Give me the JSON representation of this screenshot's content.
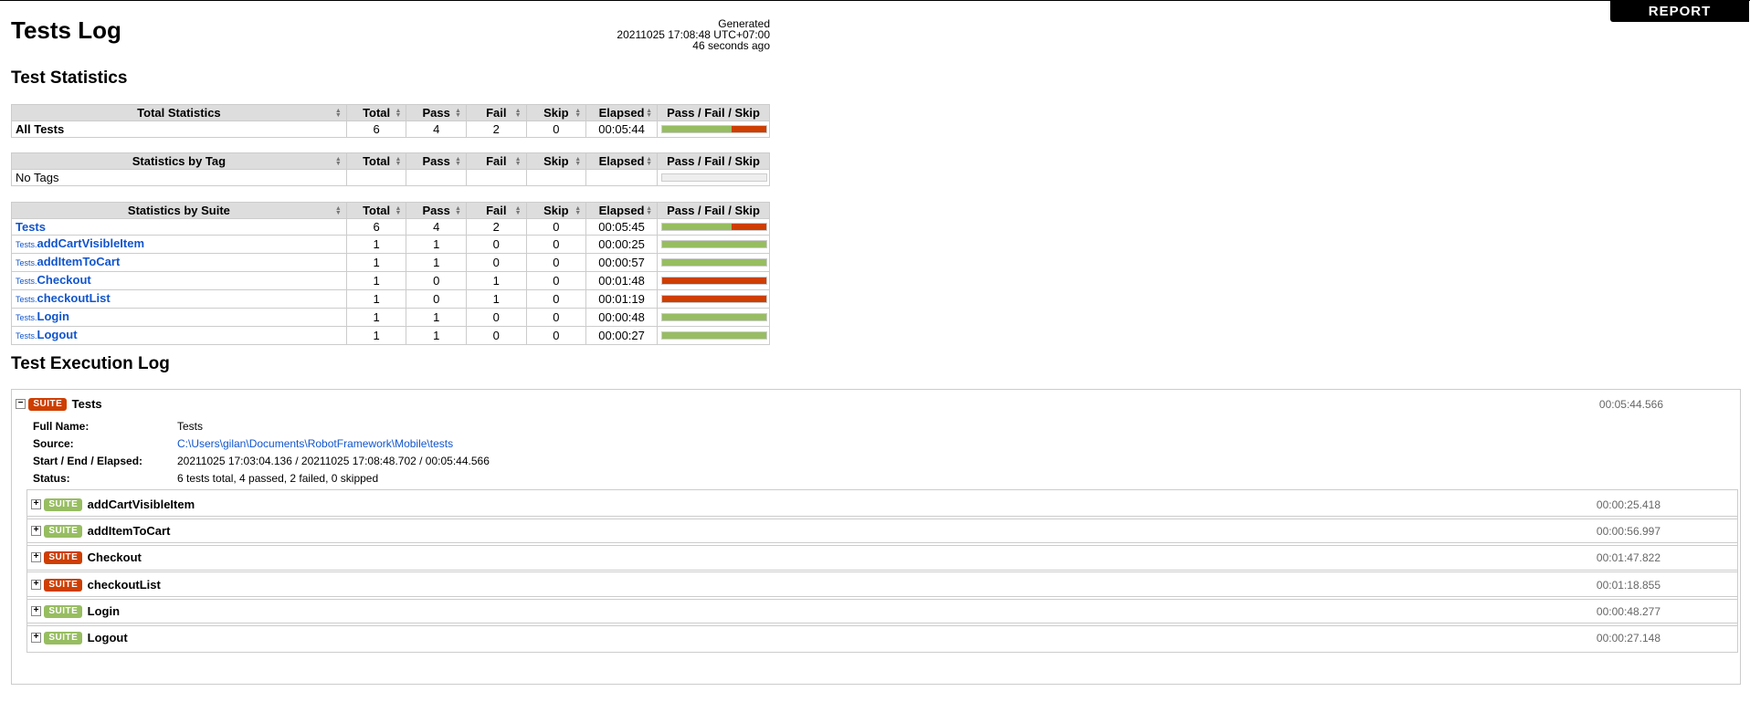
{
  "report_link": "REPORT",
  "title": "Tests Log",
  "generated": {
    "label": "Generated",
    "timestamp": "20211025 17:08:48 UTC+07:00",
    "ago": "46 seconds ago"
  },
  "sections": {
    "statistics": "Test Statistics",
    "execution": "Test Execution Log"
  },
  "columns": [
    "Total",
    "Pass",
    "Fail",
    "Skip",
    "Elapsed",
    "Pass / Fail / Skip"
  ],
  "total_stats": {
    "header": "Total Statistics",
    "rows": [
      {
        "name": "All Tests",
        "total": "6",
        "pass": "4",
        "fail": "2",
        "skip": "0",
        "elapsed": "00:05:44",
        "pass_ratio": 0.667,
        "fail_ratio": 0.333
      }
    ]
  },
  "tag_stats": {
    "header": "Statistics by Tag",
    "rows": [
      {
        "name": "No Tags",
        "total": "",
        "pass": "",
        "fail": "",
        "skip": "",
        "elapsed": "",
        "pass_ratio": 0,
        "fail_ratio": 0
      }
    ]
  },
  "suite_stats": {
    "header": "Statistics by Suite",
    "rows": [
      {
        "parent": "",
        "name": "Tests",
        "total": "6",
        "pass": "4",
        "fail": "2",
        "skip": "0",
        "elapsed": "00:05:45",
        "pass_ratio": 0.667,
        "fail_ratio": 0.333
      },
      {
        "parent": "Tests.",
        "name": "addCartVisibleItem",
        "total": "1",
        "pass": "1",
        "fail": "0",
        "skip": "0",
        "elapsed": "00:00:25",
        "pass_ratio": 1,
        "fail_ratio": 0
      },
      {
        "parent": "Tests.",
        "name": "addItemToCart",
        "total": "1",
        "pass": "1",
        "fail": "0",
        "skip": "0",
        "elapsed": "00:00:57",
        "pass_ratio": 1,
        "fail_ratio": 0
      },
      {
        "parent": "Tests.",
        "name": "Checkout",
        "total": "1",
        "pass": "0",
        "fail": "1",
        "skip": "0",
        "elapsed": "00:01:48",
        "pass_ratio": 0,
        "fail_ratio": 1
      },
      {
        "parent": "Tests.",
        "name": "checkoutList",
        "total": "1",
        "pass": "0",
        "fail": "1",
        "skip": "0",
        "elapsed": "00:01:19",
        "pass_ratio": 0,
        "fail_ratio": 1
      },
      {
        "parent": "Tests.",
        "name": "Login",
        "total": "1",
        "pass": "1",
        "fail": "0",
        "skip": "0",
        "elapsed": "00:00:48",
        "pass_ratio": 1,
        "fail_ratio": 0
      },
      {
        "parent": "Tests.",
        "name": "Logout",
        "total": "1",
        "pass": "1",
        "fail": "0",
        "skip": "0",
        "elapsed": "00:00:27",
        "pass_ratio": 1,
        "fail_ratio": 0
      }
    ]
  },
  "colors": {
    "pass": "#97bd61",
    "fail": "#ce3e01",
    "link": "#1155cc"
  },
  "execution": {
    "toggle": "−",
    "label": "SUITE",
    "name": "Tests",
    "elapsed": "00:05:44.566",
    "meta": [
      {
        "key": "Full Name:",
        "value": "Tests",
        "link": false
      },
      {
        "key": "Source:",
        "value": "C:\\Users\\gilan\\Documents\\RobotFramework\\Mobile\\tests",
        "link": true
      },
      {
        "key": "Start / End / Elapsed:",
        "value": "20211025 17:03:04.136 / 20211025 17:08:48.702 / 00:05:44.566",
        "link": false
      },
      {
        "key": "Status:",
        "value": "6 tests total, 4 passed, 2 failed, 0 skipped",
        "link": false
      }
    ],
    "children": [
      {
        "toggle": "+",
        "label": "SUITE",
        "status": "pass",
        "name": "addCartVisibleItem",
        "elapsed": "00:00:25.418"
      },
      {
        "toggle": "+",
        "label": "SUITE",
        "status": "pass",
        "name": "addItemToCart",
        "elapsed": "00:00:56.997"
      },
      {
        "toggle": "+",
        "label": "SUITE",
        "status": "fail",
        "name": "Checkout",
        "elapsed": "00:01:47.822"
      },
      {
        "toggle": "+",
        "label": "SUITE",
        "status": "fail",
        "name": "checkoutList",
        "elapsed": "00:01:18.855"
      },
      {
        "toggle": "+",
        "label": "SUITE",
        "status": "pass",
        "name": "Login",
        "elapsed": "00:00:48.277"
      },
      {
        "toggle": "+",
        "label": "SUITE",
        "status": "pass",
        "name": "Logout",
        "elapsed": "00:00:27.148"
      }
    ]
  }
}
